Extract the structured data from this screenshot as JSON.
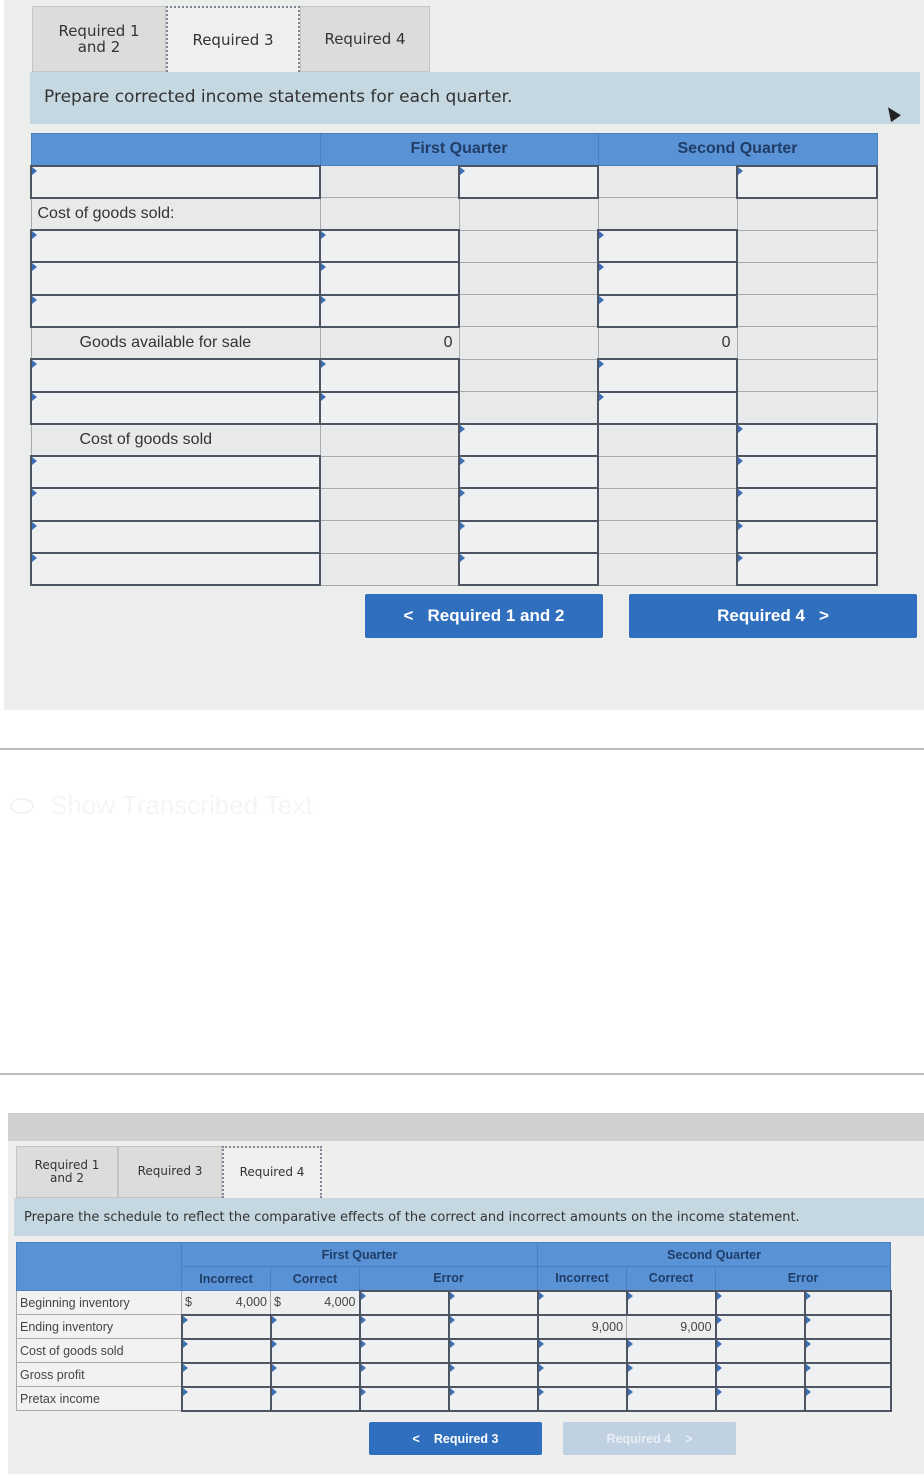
{
  "top": {
    "tabs": [
      {
        "label": "Required 1\nand 2",
        "active": false
      },
      {
        "label": "Required 3",
        "active": true
      },
      {
        "label": "Required 4",
        "active": false
      }
    ],
    "instruction": "Prepare corrected income statements for each quarter.",
    "table": {
      "headers": [
        "",
        "First Quarter",
        "Second Quarter"
      ],
      "rows": [
        {
          "label": "",
          "q1a": "",
          "q1b": "",
          "q2a": "",
          "q2b": ""
        },
        {
          "label": "Cost of goods sold:",
          "q1a": "",
          "q1b": "",
          "q2a": "",
          "q2b": ""
        },
        {
          "label": "",
          "q1a": "",
          "q1b": "",
          "q2a": "",
          "q2b": ""
        },
        {
          "label": "",
          "q1a": "",
          "q1b": "",
          "q2a": "",
          "q2b": ""
        },
        {
          "label": "",
          "q1a": "",
          "q1b": "",
          "q2a": "",
          "q2b": ""
        },
        {
          "label": "Goods available for sale",
          "q1a": "0",
          "q1b": "",
          "q2a": "0",
          "q2b": ""
        },
        {
          "label": "",
          "q1a": "",
          "q1b": "",
          "q2a": "",
          "q2b": ""
        },
        {
          "label": "",
          "q1a": "",
          "q1b": "",
          "q2a": "",
          "q2b": ""
        },
        {
          "label": "Cost of goods sold",
          "q1a": "",
          "q1b": "",
          "q2a": "",
          "q2b": ""
        },
        {
          "label": "",
          "q1a": "",
          "q1b": "",
          "q2a": "",
          "q2b": ""
        },
        {
          "label": "",
          "q1a": "",
          "q1b": "",
          "q2a": "",
          "q2b": ""
        },
        {
          "label": "",
          "q1a": "",
          "q1b": "",
          "q2a": "",
          "q2b": ""
        },
        {
          "label": "",
          "q1a": "",
          "q1b": "",
          "q2a": "",
          "q2b": ""
        }
      ]
    },
    "prev_button": {
      "arrow": "<",
      "label": "Required 1 and 2"
    },
    "next_button": {
      "label": "Required 4",
      "arrow": ">"
    }
  },
  "middle": {
    "faint_link": "Show Transcribed Text"
  },
  "bottom": {
    "tabs": [
      {
        "label": "Required 1\nand 2",
        "active": false
      },
      {
        "label": "Required 3",
        "active": false
      },
      {
        "label": "Required 4",
        "active": true
      }
    ],
    "instruction": "Prepare the schedule to reflect the comparative effects of the correct and incorrect amounts on the income statement.",
    "table": {
      "group_headers": [
        "",
        "First Quarter",
        "Second Quarter"
      ],
      "sub_headers": [
        "Incorrect",
        "Correct",
        "Error",
        "Incorrect",
        "Correct",
        "Error"
      ],
      "currency_symbol": "$",
      "rows": [
        {
          "label": "Beginning inventory",
          "q1_incorrect": "4,000",
          "q1_correct": "4,000",
          "q1_error_a": "",
          "q1_error_b": "",
          "q2_incorrect": "",
          "q2_correct": "",
          "q2_error_a": "",
          "q2_error_b": ""
        },
        {
          "label": "Ending inventory",
          "q1_incorrect": "",
          "q1_correct": "",
          "q1_error_a": "",
          "q1_error_b": "",
          "q2_incorrect": "9,000",
          "q2_correct": "9,000",
          "q2_error_a": "",
          "q2_error_b": ""
        },
        {
          "label": "Cost of goods sold",
          "q1_incorrect": "",
          "q1_correct": "",
          "q1_error_a": "",
          "q1_error_b": "",
          "q2_incorrect": "",
          "q2_correct": "",
          "q2_error_a": "",
          "q2_error_b": ""
        },
        {
          "label": "Gross profit",
          "q1_incorrect": "",
          "q1_correct": "",
          "q1_error_a": "",
          "q1_error_b": "",
          "q2_incorrect": "",
          "q2_correct": "",
          "q2_error_a": "",
          "q2_error_b": ""
        },
        {
          "label": "Pretax income",
          "q1_incorrect": "",
          "q1_correct": "",
          "q1_error_a": "",
          "q1_error_b": "",
          "q2_incorrect": "",
          "q2_correct": "",
          "q2_error_a": "",
          "q2_error_b": ""
        }
      ]
    },
    "prev_button": {
      "arrow": "<",
      "label": "Required 3"
    },
    "next_button": {
      "label": "Required 4",
      "arrow": ">",
      "disabled": true
    }
  }
}
